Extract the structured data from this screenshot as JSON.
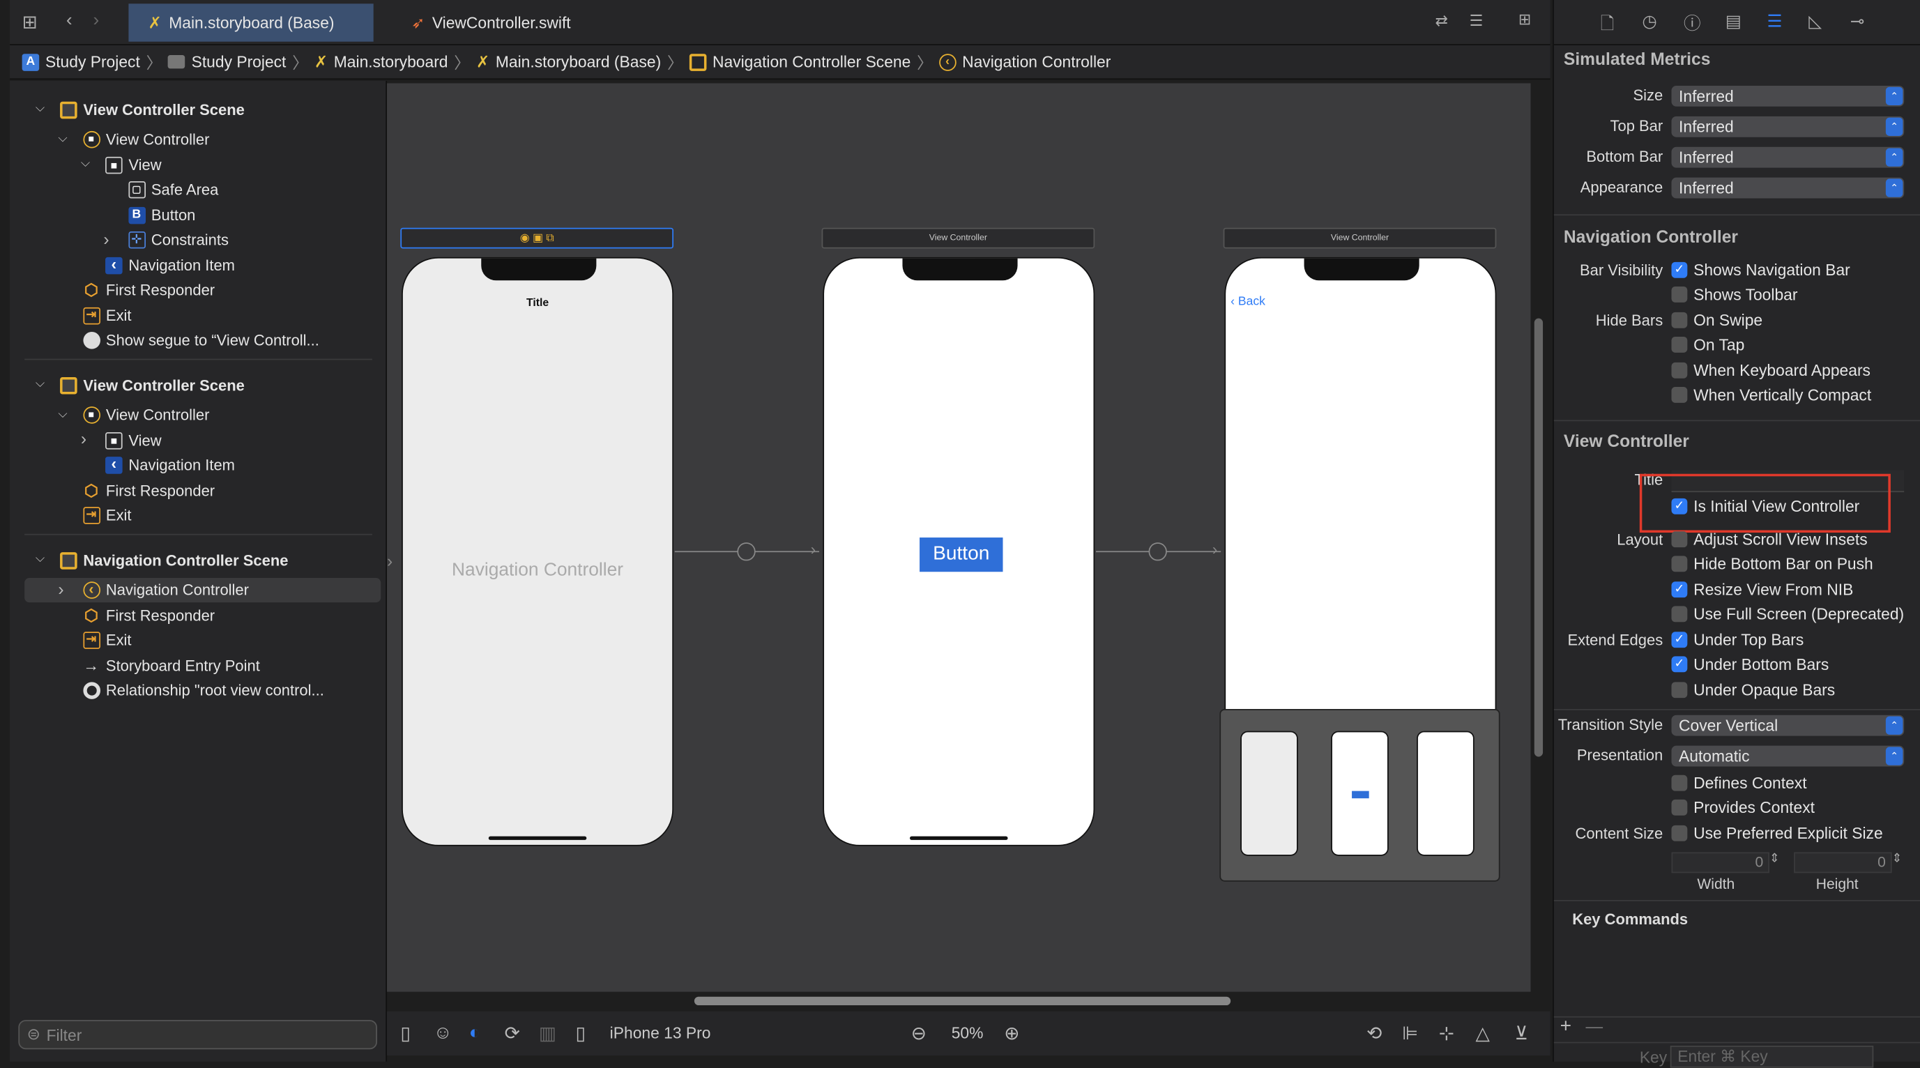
{
  "tabs": [
    {
      "label": "Main.storyboard (Base)",
      "icon": "storyboard-icon",
      "active": true
    },
    {
      "label": "ViewController.swift",
      "icon": "swift-icon",
      "active": false
    }
  ],
  "breadcrumb": [
    "Study Project",
    "Study Project",
    "Main.storyboard",
    "Main.storyboard (Base)",
    "Navigation Controller Scene",
    "Navigation Controller"
  ],
  "outline": [
    {
      "label": "View Controller Scene",
      "icon": "scene",
      "level": 0,
      "chev": "down",
      "bold": true
    },
    {
      "label": "View Controller",
      "icon": "vc",
      "level": 1,
      "chev": "down"
    },
    {
      "label": "View",
      "icon": "view",
      "level": 2,
      "chev": "down"
    },
    {
      "label": "Safe Area",
      "icon": "safearea",
      "level": 3
    },
    {
      "label": "Button",
      "icon": "button",
      "level": 3
    },
    {
      "label": "Constraints",
      "icon": "constraints",
      "level": 3,
      "chev": "right"
    },
    {
      "label": "Navigation Item",
      "icon": "navitem",
      "level": 2
    },
    {
      "label": "First Responder",
      "icon": "responder",
      "level": 1
    },
    {
      "label": "Exit",
      "icon": "exit",
      "level": 1
    },
    {
      "label": "Show segue to “View Controll...",
      "icon": "segue",
      "level": 1,
      "divider": true
    },
    {
      "label": "View Controller Scene",
      "icon": "scene",
      "level": 0,
      "chev": "down",
      "bold": true
    },
    {
      "label": "View Controller",
      "icon": "vc",
      "level": 1,
      "chev": "down"
    },
    {
      "label": "View",
      "icon": "view",
      "level": 2,
      "chev": "right"
    },
    {
      "label": "Navigation Item",
      "icon": "navitem",
      "level": 2
    },
    {
      "label": "First Responder",
      "icon": "responder",
      "level": 1
    },
    {
      "label": "Exit",
      "icon": "exit",
      "level": 1,
      "divider": true
    },
    {
      "label": "Navigation Controller Scene",
      "icon": "scene",
      "level": 0,
      "chev": "down",
      "bold": true
    },
    {
      "label": "Navigation Controller",
      "icon": "navctrl",
      "level": 1,
      "chev": "right",
      "selected": true
    },
    {
      "label": "First Responder",
      "icon": "responder",
      "level": 1
    },
    {
      "label": "Exit",
      "icon": "exit",
      "level": 1
    },
    {
      "label": "Storyboard Entry Point",
      "icon": "entry",
      "level": 1
    },
    {
      "label": "Relationship \"root view control...",
      "icon": "relationship",
      "level": 1
    }
  ],
  "filter_placeholder": "Filter",
  "canvas": {
    "scene1_title": "Title",
    "scene1_label": "Navigation Controller",
    "scene2_bar": "View Controller",
    "scene2_button": "Button",
    "scene3_bar": "View Controller",
    "scene3_back": "Back"
  },
  "bottombar": {
    "device": "iPhone 13 Pro",
    "zoom": "50%"
  },
  "inspector": {
    "simulated_metrics": {
      "header": "Simulated Metrics",
      "rows": [
        {
          "label": "Size",
          "value": "Inferred"
        },
        {
          "label": "Top Bar",
          "value": "Inferred"
        },
        {
          "label": "Bottom Bar",
          "value": "Inferred"
        },
        {
          "label": "Appearance",
          "value": "Inferred"
        }
      ]
    },
    "nav_controller": {
      "header": "Navigation Controller",
      "checks": [
        {
          "group": "Bar Visibility",
          "label": "Shows Navigation Bar",
          "checked": true
        },
        {
          "label": "Shows Toolbar",
          "checked": false
        },
        {
          "group": "Hide Bars",
          "label": "On Swipe",
          "checked": false
        },
        {
          "label": "On Tap",
          "checked": false
        },
        {
          "label": "When Keyboard Appears",
          "checked": false
        },
        {
          "label": "When Vertically Compact",
          "checked": false
        }
      ]
    },
    "view_controller": {
      "header": "View Controller",
      "title_label": "Title",
      "title_value": "",
      "initial": {
        "label": "Is Initial View Controller",
        "checked": true
      },
      "checks": [
        {
          "group": "Layout",
          "label": "Adjust Scroll View Insets",
          "checked": false
        },
        {
          "label": "Hide Bottom Bar on Push",
          "checked": false
        },
        {
          "label": "Resize View From NIB",
          "checked": true
        },
        {
          "label": "Use Full Screen (Deprecated)",
          "checked": false
        },
        {
          "group": "Extend Edges",
          "label": "Under Top Bars",
          "checked": true
        },
        {
          "label": "Under Bottom Bars",
          "checked": true
        },
        {
          "label": "Under Opaque Bars",
          "checked": false
        }
      ],
      "transition_label": "Transition Style",
      "transition_value": "Cover Vertical",
      "presentation_label": "Presentation",
      "presentation_value": "Automatic",
      "checks2": [
        {
          "label": "Defines Context",
          "checked": false
        },
        {
          "label": "Provides Context",
          "checked": false
        },
        {
          "group": "Content Size",
          "label": "Use Preferred Explicit Size",
          "checked": false
        }
      ],
      "width_value": "0",
      "height_value": "0",
      "width_label": "Width",
      "height_label": "Height"
    },
    "key_commands": {
      "header": "Key Commands",
      "key_label": "Key",
      "key_placeholder": "Enter ⌘ Key"
    }
  },
  "colors": {
    "accent": "#2f7cf6",
    "tab_active": "#3b5070",
    "highlight_box": "#e0392b",
    "canvas": "#3b3b3d"
  }
}
